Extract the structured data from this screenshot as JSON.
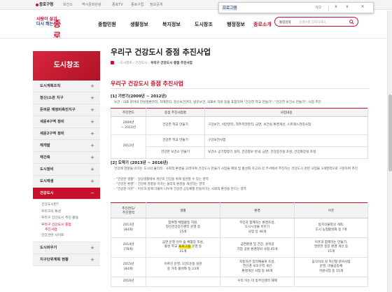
{
  "topbar": {
    "home": "종로구청",
    "links": [
      "보건소",
      "역사문화관광",
      "종로TV",
      "종로구립",
      "정보공개"
    ]
  },
  "findbar": {
    "query": "프로그램",
    "count": "0/2",
    "up": "∧",
    "down": "∨",
    "close": "×"
  },
  "header": {
    "logo_line1": "사람이 살기",
    "logo_line2": "다시 뛰는",
    "logo_big": "종로",
    "nav": [
      "종합민원",
      "생활정보",
      "복지정보",
      "도시창조",
      "행정정보",
      "종로소개"
    ],
    "search_select": "통합검색",
    "search_placeholder": "검색어를 입력하세요"
  },
  "sidebar": {
    "title": "도시창조",
    "items": [
      {
        "label": "도시계획조직",
        "pm": "+"
      },
      {
        "label": "정신(소관 지구",
        "pm": "+"
      },
      {
        "label": "돈의문 재정비촉진지구",
        "pm": "+"
      },
      {
        "label": "세운4구역 정비",
        "pm": "+"
      },
      {
        "label": "세운2구역 정비",
        "pm": "+"
      },
      {
        "label": "재개발",
        "pm": "+"
      },
      {
        "label": "재건축",
        "pm": "+"
      },
      {
        "label": "도시정비",
        "pm": "+"
      },
      {
        "label": "도시재생",
        "pm": "+"
      },
      {
        "label": "건강도시",
        "pm": "−"
      }
    ],
    "subitems": [
      "건강도시란?",
      "우리구의 특성",
      "우리구 건강도시 추진 활동",
      "우리구 건강도시 중점",
      "추진사업",
      "건강관련 사이트"
    ],
    "items_after": [
      {
        "label": "도시비우기",
        "pm": "+"
      },
      {
        "label": "지구단위계획 현황",
        "pm": "+"
      }
    ]
  },
  "content": {
    "title": "우리구 건강도시 중점 추진사업",
    "breadcrumb": [
      "도시창조",
      "건강도시",
      "우리구 건강도시 중점 추진사업"
    ],
    "subtitle": "우리구 건강도시 중점 추진사업",
    "sec1": "[1] 기반기(2009년 ~ 2012년)",
    "para1": "보건 · 의료 분야의 만성질환관리, 치매관리, 정신보건관리, 방문보건, 의료비 지원 등을 포함하여 \"건강한 학교 만들기\", \"건강한 보건소 만들기\", 사업 추진",
    "t1_head": [
      "추진연도",
      "중점 추진사업명",
      "사업내용"
    ],
    "t1_rows": [
      [
        "2009년\n~ 2011년",
        "건강한 학교 만들기",
        "구강보건, 비만관리, 척추측만관리, 금연, 보건실 환경개선, 스트레스관리사업"
      ],
      [
        "2012년",
        "건강한 학교 만들기",
        "구강보건사업"
      ],
      [
        "",
        "건강한 보건소 만들기",
        "보건소 공기청정기 설치, 건강정보 안내, 금연, 건강증진실 조성, 건강화장실 조성"
      ]
    ],
    "sec2": "[2] 도약기 (2013년 ~ 2016년)",
    "para2": "건강에 영향을 미치는 도시의 물리적 · 사회적 환경을 고려하여 건강도시 만들기 사업을 확대 및 활성화 하고자 각 부서에서 추진하는 건강도시 관련 사업을 3개영역으로 구분하여 추진",
    "bullets": [
      "\"건강한 생활\" : 일상생활에서 개인의 건강을 위해 실천할 수 있는 영역",
      "\"건강한 환경\" : 건강에 영향을 미치는 물리적 환경을 개선하는 영역",
      "\"건강한 이웃\" : 이웃과 함께 더불어 나누며 건강한 공동체를 만들어가는 사회적 환경을 만드는 영역"
    ],
    "t2_head": [
      "추진연도/\n추진영역",
      "생활",
      "환경",
      "이웃"
    ],
    "t2_rows": [
      [
        "2013년\n(84개)",
        "참여형 체험활동 지원,\n정신건강증진센터 운영 등\n15개",
        "주민과 함께하는 환경조성,\n도시시설물 비우기\n사업 등 46개",
        "동지식물악의 개최,\n도시 농업활성화 등 ?개"
      ],
      [
        "2014년\n(78개)",
        "금연 운영 유아 숲 체험장 조성,\n활성 학교 프로그램 운영 등\n21개",
        "금연환경 및 건강, 골목길\n기업 공원 환경정비 사업 45개",
        "이웃과 함께하는 만들기,\n연천한 중장 환경 개선 등\n15개"
      ],
      [
        "2015년\n(84개)",
        "어르신 운영, 1인1운동 실천\n중 가족 활성화 등 23개",
        "자동하관 장리예술로 조성,\n한신경 보호구역 개선\n환경개선 사업 등 46개",
        "음식이의 실 혁신형 분야사업\n운영, 마을공동체\n지원사업 등 15개"
      ],
      [
        "2016년",
        "",
        "우리 이는 미 동주민센터 해제",
        ""
      ]
    ]
  },
  "colors": {
    "accent": "#c8102e",
    "navy": "#1a3e8c",
    "highlight": "#ffe600"
  }
}
